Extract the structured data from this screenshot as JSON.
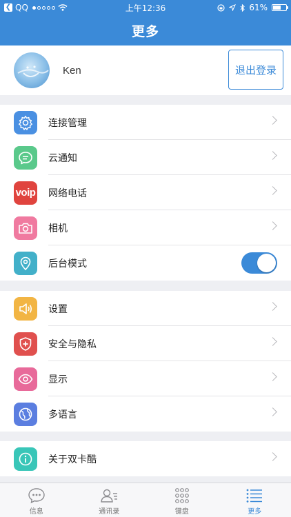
{
  "status_bar": {
    "carrier": "QQ",
    "time": "上午12:36",
    "battery": "61%",
    "battery_level": 0.61
  },
  "header": {
    "title": "更多"
  },
  "profile": {
    "name": "Ken",
    "logout_label": "退出登录"
  },
  "groups": [
    {
      "items": [
        {
          "label": "连接管理",
          "icon": "gear-icon",
          "color": "#4a90e2"
        },
        {
          "label": "云通知",
          "icon": "chat-bubble-icon",
          "color": "#5ac98b"
        },
        {
          "label": "网络电话",
          "icon": "voip-icon",
          "icon_text": "voip",
          "color": "#e0443e"
        },
        {
          "label": "相机",
          "icon": "camera-icon",
          "color": "#f07aa0"
        },
        {
          "label": "后台模式",
          "icon": "location-pin-icon",
          "color": "#42b0c9",
          "toggle_on": true
        }
      ]
    },
    {
      "items": [
        {
          "label": "设置",
          "icon": "speaker-icon",
          "color": "#f2b544"
        },
        {
          "label": "安全与隐私",
          "icon": "shield-icon",
          "color": "#e0504e"
        },
        {
          "label": "显示",
          "icon": "eye-icon",
          "color": "#e86a9a"
        },
        {
          "label": "多语言",
          "icon": "globe-icon",
          "color": "#5b7ee0"
        }
      ]
    },
    {
      "items": [
        {
          "label": "关于双卡酷",
          "icon": "info-icon",
          "color": "#39c6b8"
        }
      ]
    }
  ],
  "tabbar": {
    "tabs": [
      {
        "label": "信息",
        "icon": "message-icon"
      },
      {
        "label": "通讯录",
        "icon": "contacts-icon"
      },
      {
        "label": "键盘",
        "icon": "dialpad-icon"
      },
      {
        "label": "更多",
        "icon": "list-icon",
        "active": true
      }
    ]
  }
}
